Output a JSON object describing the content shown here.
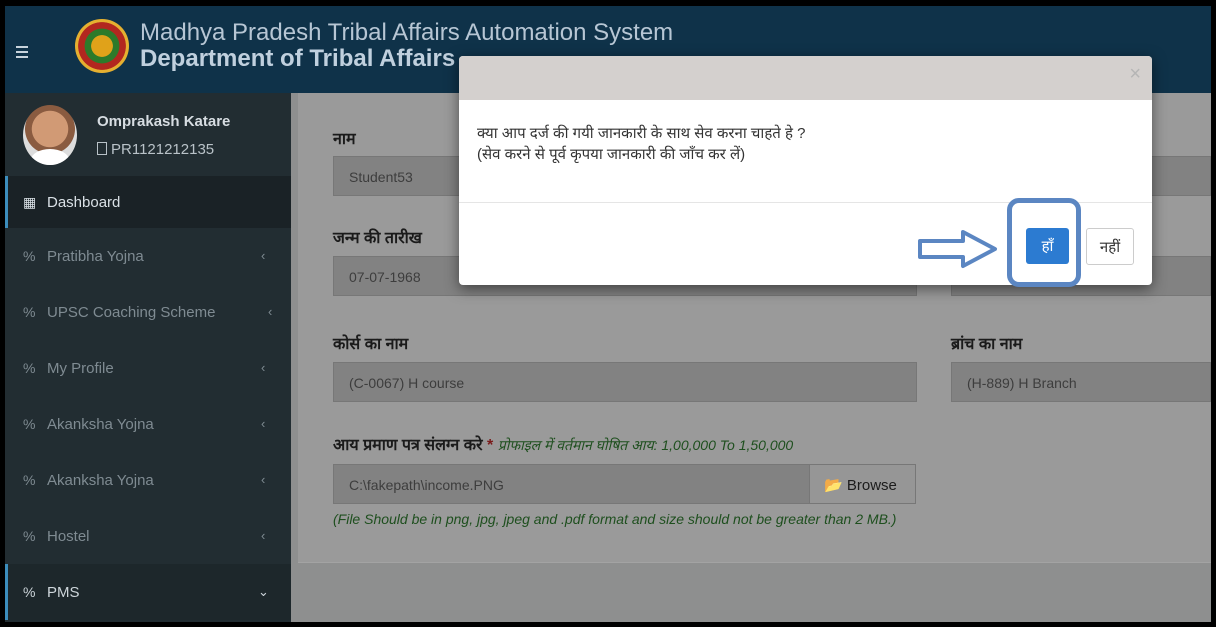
{
  "header": {
    "title": "Madhya Pradesh Tribal Affairs Automation System",
    "subtitle": "Department of Tribal Affairs"
  },
  "user": {
    "name": "Omprakash Katare",
    "id": "PR1121212135"
  },
  "sidebar": {
    "items": [
      {
        "label": "Dashboard",
        "icon": "th-grid-icon"
      },
      {
        "label": "Pratibha Yojna",
        "icon": "percent-icon"
      },
      {
        "label": "UPSC Coaching Scheme",
        "icon": "percent-icon"
      },
      {
        "label": "My Profile",
        "icon": "percent-icon"
      },
      {
        "label": "Akanksha Yojna",
        "icon": "percent-icon"
      },
      {
        "label": "Akanksha Yojna",
        "icon": "percent-icon"
      },
      {
        "label": "Hostel",
        "icon": "percent-icon"
      },
      {
        "label": "PMS",
        "icon": "percent-icon"
      }
    ]
  },
  "form": {
    "name_label": "नाम",
    "name_value": "Student53",
    "dob_label": "जन्म की तारीख",
    "dob_value": "07-07-1968",
    "course_label": "कोर्स का नाम",
    "course_value": "(C-0067) H course",
    "branch_label": "ब्रांच का नाम",
    "branch_value": "(H-889) H Branch",
    "income_label": "आय प्रमाण पत्र संलग्न करे",
    "income_required": "*",
    "income_note": "प्रोफाइल में वर्तमान घोषित आय: 1,00,000 To 1,50,000",
    "file_value": "C:\\fakepath\\income.PNG",
    "browse_label": "Browse",
    "file_note": "(File Should be in png, jpg, jpeg and .pdf format and size should not be greater than 2 MB.)"
  },
  "modal": {
    "close": "×",
    "line1": "क्या आप दर्ज की गयी जानकारी के साथ सेव करना चाहते हे ?",
    "line2": "(सेव करने से पूर्व कृपया जानकारी की जाँच कर लें)",
    "yes": "हाँ",
    "no": "नहीं"
  },
  "colors": {
    "header_bg": "#0f3249",
    "sidebar_bg": "#222d32",
    "accent": "#3c8dbc",
    "yes_button": "#2c7bd1",
    "annotation": "#5b86c2"
  }
}
